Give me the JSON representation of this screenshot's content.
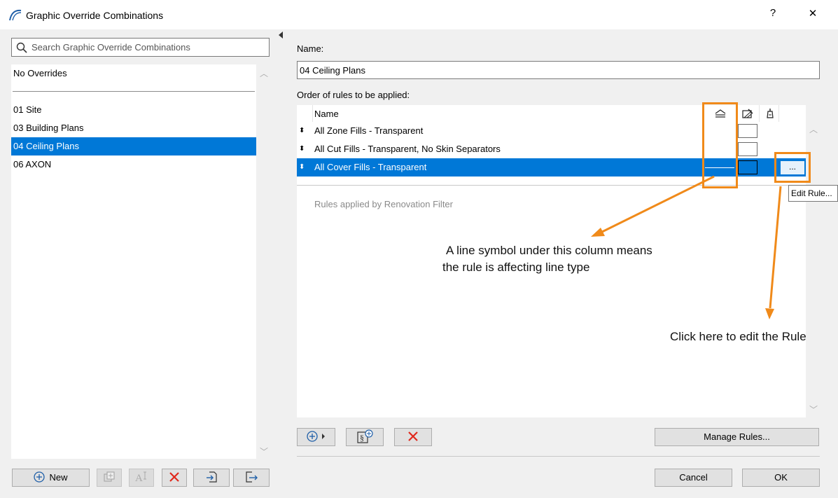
{
  "window": {
    "title": "Graphic Override Combinations",
    "help_label": "?",
    "close_label": "✕"
  },
  "search": {
    "placeholder": "Search Graphic Override Combinations"
  },
  "combinations": {
    "no_overrides": "No Overrides",
    "items": [
      "01 Site",
      "03 Building Plans",
      "04 Ceiling Plans",
      "06 AXON"
    ],
    "selected_index": 2
  },
  "left_toolbar": {
    "new_label": "New"
  },
  "name_field": {
    "label": "Name:",
    "value": "04 Ceiling Plans"
  },
  "rules": {
    "label": "Order of rules to be applied:",
    "column_name": "Name",
    "rows": [
      "All Zone Fills - Transparent",
      "All Cut Fills - Transparent, No Skin Separators",
      "All Cover Fills - Transparent"
    ],
    "selected_index": 2,
    "renovation_text": "Rules applied by Renovation Filter",
    "edit_button_label": "...",
    "edit_tooltip": "Edit Rule..."
  },
  "annotations": {
    "line_symbol_1": "A line symbol under this column means",
    "line_symbol_2": "the rule is affecting line type",
    "edit_rule": "Click here to edit the Rule"
  },
  "right_toolbar": {
    "manage_rules_label": "Manage Rules..."
  },
  "dialog_buttons": {
    "cancel_label": "Cancel",
    "ok_label": "OK"
  },
  "colors": {
    "selection": "#0078d7",
    "annotation_orange": "#f08a1a",
    "delete_red": "#e0281c",
    "icon_blue": "#1f5fa8"
  }
}
